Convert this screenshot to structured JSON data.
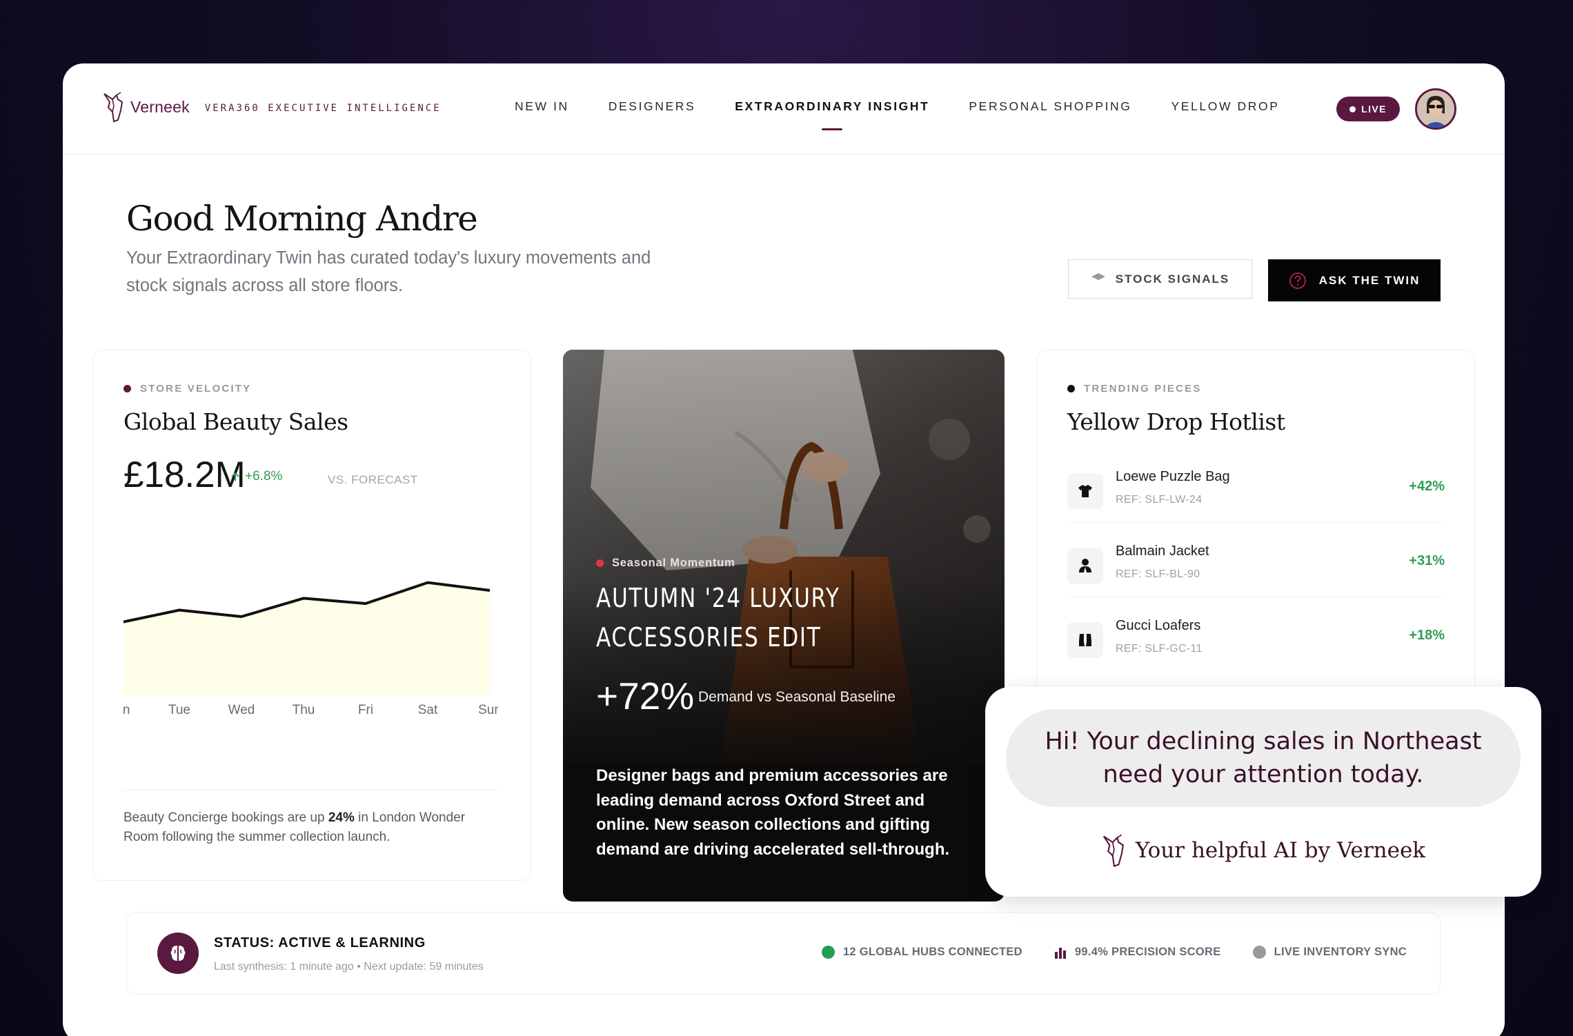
{
  "brand": {
    "name": "Verneek",
    "subtitle": "VERA360 EXECUTIVE INTELLIGENCE",
    "color": "#5a1940"
  },
  "nav": {
    "items": [
      {
        "label": "NEW IN"
      },
      {
        "label": "DESIGNERS"
      },
      {
        "label": "EXTRAORDINARY INSIGHT",
        "active": true
      },
      {
        "label": "PERSONAL SHOPPING"
      },
      {
        "label": "YELLOW DROP"
      }
    ],
    "live_label": "LIVE"
  },
  "greeting": {
    "title": "Good Morning Andre",
    "subtitle": "Your Extraordinary Twin has curated today's luxury movements and stock signals across all store floors."
  },
  "actions": {
    "stock_signals": "STOCK SIGNALS",
    "ask_twin": "ASK THE TWIN"
  },
  "velocity_card": {
    "eyebrow": "STORE VELOCITY",
    "title": "Global Beauty Sales",
    "value": "£18.2M",
    "change": "+6.8%",
    "vs": "VS. FORECAST",
    "note_prefix": "Beauty Concierge bookings are up ",
    "note_highlight": "24%",
    "note_suffix": " in London Wonder Room following the summer collection launch.",
    "accent": "#5a1940",
    "fill_color": "#fffee9"
  },
  "chart_data": {
    "type": "area",
    "categories": [
      "Mon",
      "Tue",
      "Wed",
      "Thu",
      "Fri",
      "Sat",
      "Sun"
    ],
    "values": [
      0.55,
      0.65,
      0.6,
      0.74,
      0.7,
      0.86,
      0.8
    ],
    "ylim": [
      0,
      1
    ],
    "grid": false
  },
  "hero": {
    "eyebrow": "Seasonal Momentum",
    "title": "AUTUMN '24 LUXURY ACCESSORIES EDIT",
    "stat": "+72%",
    "stat_label": "Demand vs Seasonal Baseline",
    "body": "Designer bags and premium accessories are leading demand across Oxford Street and online. New season collections and gifting demand are driving accelerated sell-through."
  },
  "hotlist": {
    "eyebrow": "TRENDING PIECES",
    "title": "Yellow Drop Hotlist",
    "items": [
      {
        "name": "Loewe Puzzle Bag",
        "ref": "REF: SLF-LW-24",
        "change": "+42%",
        "icon": "shirt-icon"
      },
      {
        "name": "Balmain Jacket",
        "ref": "REF: SLF-BL-90",
        "change": "+31%",
        "icon": "person-icon"
      },
      {
        "name": "Gucci Loafers",
        "ref": "REF: SLF-GC-11",
        "change": "+18%",
        "icon": "boots-icon"
      }
    ]
  },
  "assistant": {
    "message": "Hi! Your declining sales in Northeast need your attention today.",
    "signature": "Your helpful AI by Verneek"
  },
  "status": {
    "title": "STATUS: ACTIVE & LEARNING",
    "subtitle": "Last synthesis: 1 minute ago • Next update: 59 minutes",
    "metrics": [
      {
        "label": "12 GLOBAL HUBS CONNECTED",
        "color": "#22a04f"
      },
      {
        "label": "99.4% PRECISION SCORE",
        "color": "#5a1940"
      },
      {
        "label": "LIVE INVENTORY SYNC",
        "color": "#9a9a9a"
      }
    ]
  }
}
